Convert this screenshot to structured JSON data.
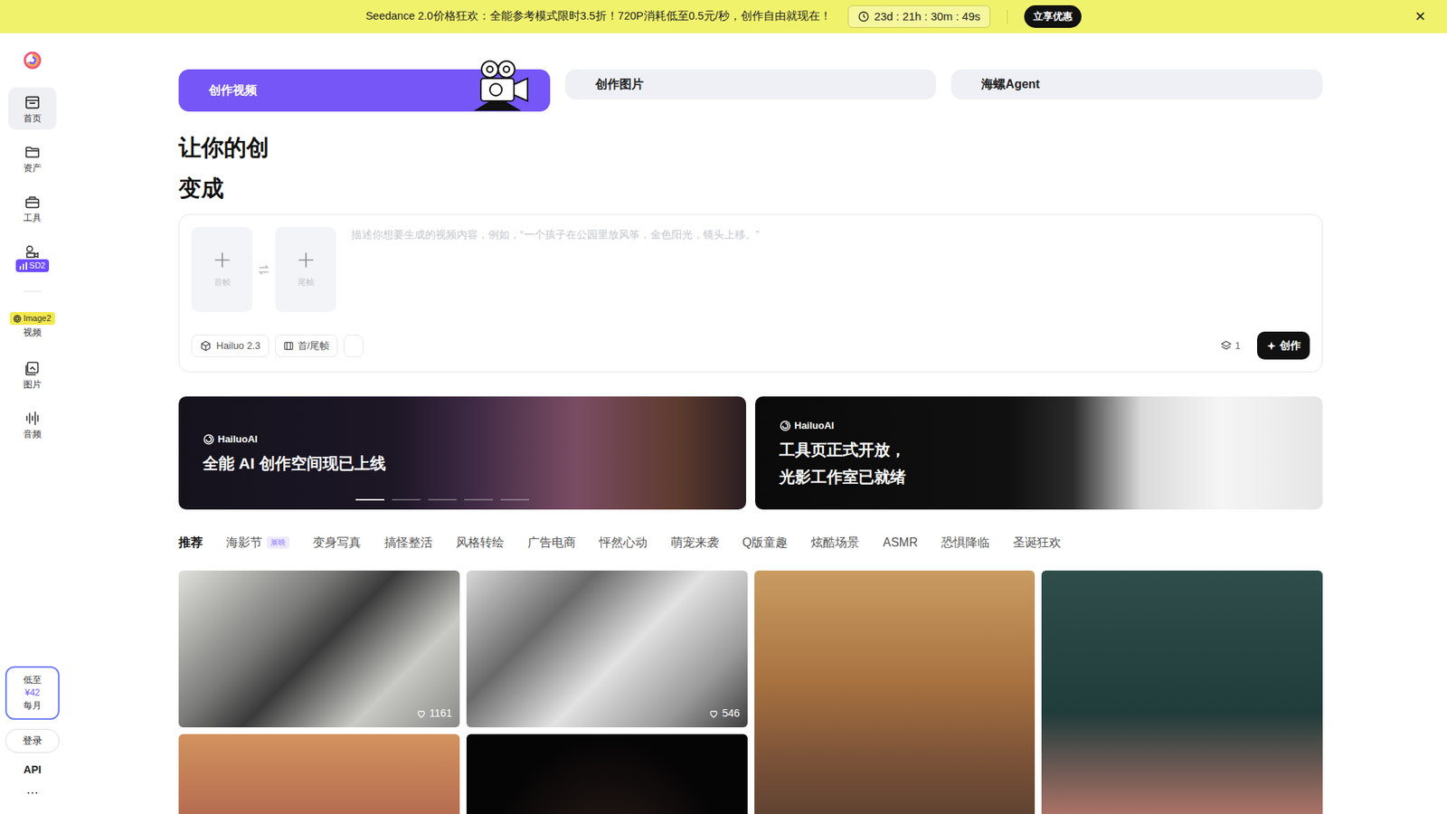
{
  "promo_bar": {
    "text": "Seedance 2.0价格狂欢：全能参考模式限时3.5折！720P消耗低至0.5元/秒，创作自由就现在！",
    "countdown": "23d : 21h : 30m : 49s",
    "button": "立享优惠",
    "close": "✕"
  },
  "sidebar": {
    "items": [
      {
        "kind": "nav",
        "label": "首页",
        "selected": true
      },
      {
        "kind": "nav",
        "label": "资产",
        "selected": false
      },
      {
        "kind": "nav",
        "label": "工具",
        "selected": false
      },
      {
        "kind": "badge",
        "badge": "SD2",
        "selected": false
      },
      {
        "kind": "badge-nav",
        "badge": "Image2",
        "label": "视频",
        "selected": false
      },
      {
        "kind": "nav",
        "label": "图片",
        "selected": false
      },
      {
        "kind": "nav",
        "label": "音频",
        "selected": false
      }
    ],
    "pricing": {
      "line1": "低至",
      "price": "¥42",
      "line2": "每月"
    },
    "login": "登录",
    "api": "API",
    "more": "⋯"
  },
  "mode_tabs": [
    {
      "label": "创作视频",
      "selected": true
    },
    {
      "label": "创作图片",
      "selected": false
    },
    {
      "label": "海螺Agent",
      "selected": false
    }
  ],
  "headline": [
    "让你的创",
    "变成"
  ],
  "composer": {
    "frames": [
      {
        "label": "首帧"
      },
      {
        "label": "尾帧"
      }
    ],
    "placeholder": "描述你想要生成的视频内容，例如，“一个孩子在公园里放风筝，金色阳光，镜头上移。”",
    "model": "Hailuo 2.3",
    "mode": "首/尾帧",
    "count": "1",
    "submit": "创作"
  },
  "promos": [
    {
      "brand": "HailuoAI",
      "lines": [
        "全能 AI 创作空间现已上线"
      ],
      "dots": [
        {
          "selected": true
        },
        {
          "selected": false
        },
        {
          "selected": false
        },
        {
          "selected": false
        },
        {
          "selected": false
        }
      ]
    },
    {
      "brand": "HailuoAI",
      "lines": [
        "工具页正式开放，",
        "光影工作室已就绪"
      ],
      "dots": []
    }
  ],
  "categories": [
    {
      "label": "推荐",
      "selected": true
    },
    {
      "label": "海影节",
      "selected": false,
      "badge": "展映"
    },
    {
      "label": "变身写真",
      "selected": false
    },
    {
      "label": "搞怪整活",
      "selected": false
    },
    {
      "label": "风格转绘",
      "selected": false
    },
    {
      "label": "广告电商",
      "selected": false
    },
    {
      "label": "怦然心动",
      "selected": false
    },
    {
      "label": "萌宠来袭",
      "selected": false
    },
    {
      "label": "Q版童趣",
      "selected": false
    },
    {
      "label": "炫酷场景",
      "selected": false
    },
    {
      "label": "ASMR",
      "selected": false
    },
    {
      "label": "恐惧降临",
      "selected": false
    },
    {
      "label": "圣诞狂欢",
      "selected": false
    }
  ],
  "gallery": {
    "columns": [
      [
        {
          "kind": "liked",
          "likes": "1161"
        },
        {
          "kind": "plain"
        }
      ],
      [
        {
          "kind": "liked",
          "likes": "546"
        },
        {
          "kind": "plain"
        }
      ],
      [
        {
          "kind": "plain"
        }
      ],
      [
        {
          "kind": "plain"
        }
      ]
    ]
  }
}
